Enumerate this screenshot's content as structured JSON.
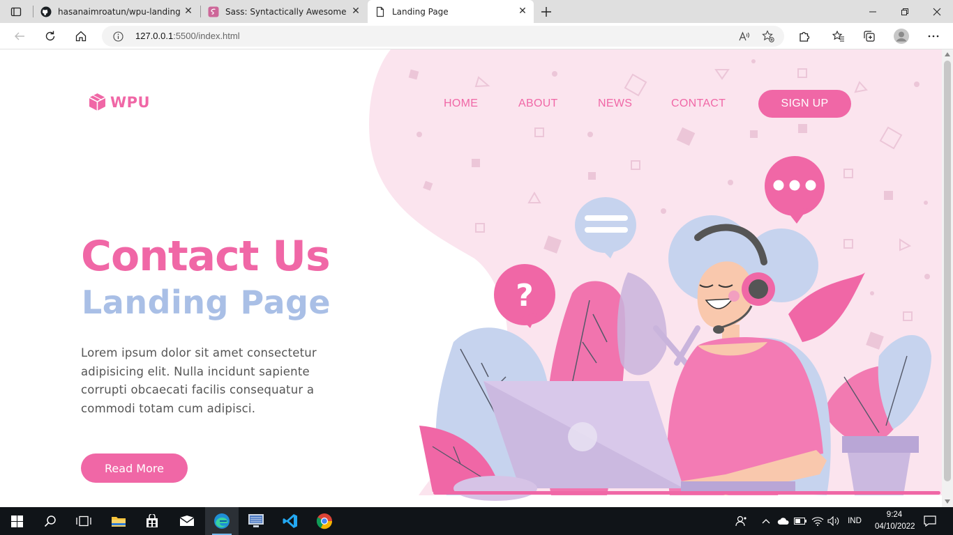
{
  "browser": {
    "tabs": [
      {
        "title": "hasanaimroatun/wpu-landingPage",
        "icon": "github-icon"
      },
      {
        "title": "Sass: Syntactically Awesome Style",
        "icon": "sass-icon"
      },
      {
        "title": "Landing Page",
        "icon": "page-icon"
      }
    ],
    "url_host": "127.0.0.1",
    "url_rest": ":5500/index.html"
  },
  "site": {
    "logo": "WPU",
    "nav": [
      "HOME",
      "ABOUT",
      "NEWS",
      "CONTACT"
    ],
    "signup": "SIGN UP",
    "hero_title": "Contact Us",
    "hero_subtitle": "Landing Page",
    "hero_text": "Lorem ipsum dolor sit amet consectetur adipisicing elit. Nulla incidunt sapiente corrupti obcaecati facilis consequatur a commodi totam cum adipisci.",
    "cta": "Read More",
    "colors": {
      "brand": "#f067a6",
      "accent": "#a9bfe6",
      "blob": "#fbe4ee"
    }
  },
  "taskbar": {
    "language": "IND",
    "time": "9:24",
    "date": "04/10/2022"
  }
}
